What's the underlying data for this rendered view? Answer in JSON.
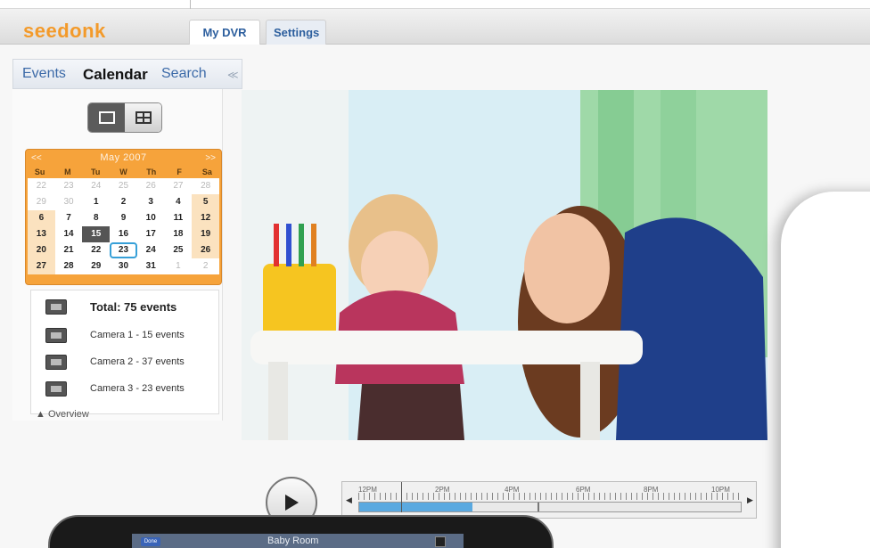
{
  "app": {
    "logo": "seedonk"
  },
  "tabs": [
    {
      "label": "My DVR",
      "active": true
    },
    {
      "label": "Settings",
      "active": false
    }
  ],
  "subnav": {
    "events": "Events",
    "calendar": "Calendar",
    "search": "Search",
    "more": "≪"
  },
  "view_toggle": {
    "single": "single-view-icon",
    "grid": "grid-view-icon",
    "selected": "single"
  },
  "calendar": {
    "prev": "<<",
    "month": "May 2007",
    "next": ">>",
    "dow": [
      "Su",
      "M",
      "Tu",
      "W",
      "Th",
      "F",
      "Sa"
    ],
    "days": [
      "22",
      "23",
      "24",
      "25",
      "26",
      "27",
      "28",
      "29",
      "30",
      "1",
      "2",
      "3",
      "4",
      "5",
      "6",
      "7",
      "8",
      "9",
      "10",
      "11",
      "12",
      "13",
      "14",
      "15",
      "16",
      "17",
      "18",
      "19",
      "20",
      "21",
      "22",
      "23",
      "24",
      "25",
      "26",
      "27",
      "28",
      "29",
      "30",
      "31",
      "1",
      "2"
    ],
    "selected": "15",
    "today": "23",
    "accent": "#f6a33b"
  },
  "events": {
    "total": "Total: 75 events",
    "cameras": [
      "Camera 1 - 15 events",
      "Camera 2 - 37 events",
      "Camera 3 - 23 events"
    ],
    "overview": "▲ Overview"
  },
  "timeline": {
    "labels": [
      "12PM",
      "2PM",
      "4PM",
      "6PM",
      "8PM",
      "10PM"
    ],
    "prev": "◀",
    "next": "▶"
  },
  "phone": {
    "title": "Baby Room",
    "back": "Done"
  }
}
